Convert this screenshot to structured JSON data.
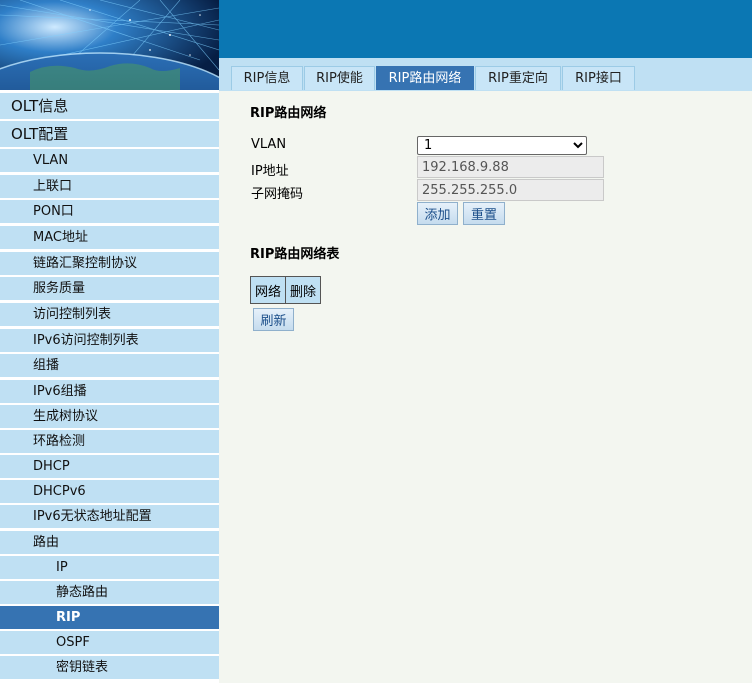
{
  "tabs": [
    {
      "label": "RIP信息",
      "active": false
    },
    {
      "label": "RIP使能",
      "active": false
    },
    {
      "label": "RIP路由网络",
      "active": true
    },
    {
      "label": "RIP重定向",
      "active": false
    },
    {
      "label": "RIP接口",
      "active": false
    }
  ],
  "sidebar": {
    "items": [
      {
        "label": "OLT信息",
        "level": 1
      },
      {
        "label": "OLT配置",
        "level": 1
      },
      {
        "label": "VLAN",
        "level": 2
      },
      {
        "label": "上联口",
        "level": 2
      },
      {
        "label": "PON口",
        "level": 2
      },
      {
        "label": "MAC地址",
        "level": 2
      },
      {
        "label": "链路汇聚控制协议",
        "level": 2
      },
      {
        "label": "服务质量",
        "level": 2
      },
      {
        "label": "访问控制列表",
        "level": 2
      },
      {
        "label": "IPv6访问控制列表",
        "level": 2
      },
      {
        "label": "组播",
        "level": 2
      },
      {
        "label": "IPv6组播",
        "level": 2
      },
      {
        "label": "生成树协议",
        "level": 2
      },
      {
        "label": "环路检测",
        "level": 2
      },
      {
        "label": "DHCP",
        "level": 2
      },
      {
        "label": "DHCPv6",
        "level": 2
      },
      {
        "label": "IPv6无状态地址配置",
        "level": 2
      },
      {
        "label": "路由",
        "level": 2
      },
      {
        "label": "IP",
        "level": 3
      },
      {
        "label": "静态路由",
        "level": 3
      },
      {
        "label": "RIP",
        "level": 3,
        "active": true
      },
      {
        "label": "OSPF",
        "level": 3
      },
      {
        "label": "密钥链表",
        "level": 3
      }
    ]
  },
  "form": {
    "title": "RIP路由网络",
    "vlan_label": "VLAN",
    "vlan_value": "1",
    "ip_label": "IP地址",
    "ip_value": "192.168.9.88",
    "mask_label": "子网掩码",
    "mask_value": "255.255.255.0",
    "add_label": "添加",
    "reset_label": "重置"
  },
  "table": {
    "title": "RIP路由网络表",
    "headers": [
      "网络",
      "删除"
    ],
    "refresh_label": "刷新"
  },
  "colors": {
    "header_blue": "#0b77b3",
    "nav_bg": "#bfe0f3",
    "active_bg": "#3673b2",
    "content_bg": "#f3f6f0"
  }
}
